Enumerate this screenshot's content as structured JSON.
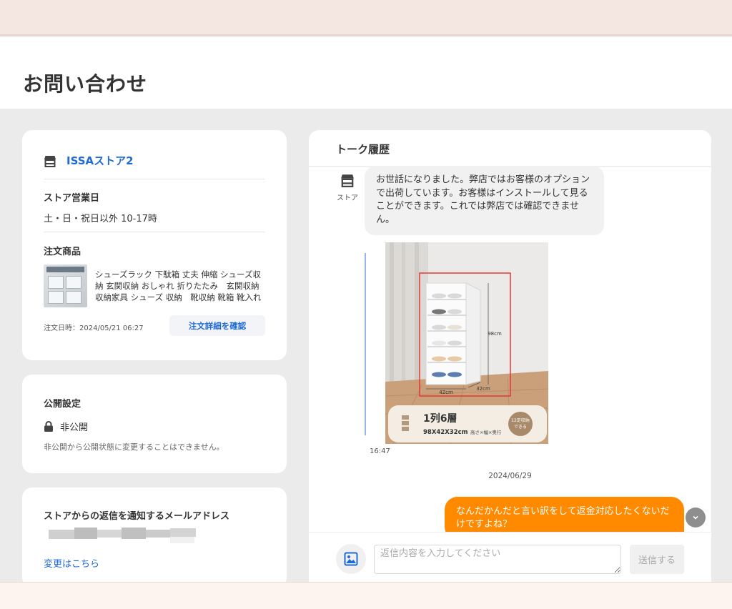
{
  "page": {
    "title": "お問い合わせ"
  },
  "store": {
    "name": "ISSAストア2",
    "hours_title": "ストア営業日",
    "hours": "土・日・祝日以外 10-17時",
    "order_title": "注文商品",
    "product_name": "シューズラック 下駄箱 丈夫 伸縮 シューズ収納 玄関収納 おしゃれ 折りたたみ　玄関収納 収納家具 シューズ 収納　靴収納 靴箱 靴入れ",
    "order_date": "注文日時：2024/05/21 06:27",
    "detail_button": "注文詳細を確認"
  },
  "visibility": {
    "title": "公開設定",
    "status": "非公開",
    "note": "非公開から公開状態に変更することはできません。"
  },
  "email": {
    "title": "ストアからの返信を通知するメールアドレス",
    "change_link": "変更はこちら"
  },
  "chat": {
    "title": "トーク履歴",
    "avatar_label": "ストア",
    "incoming_message": "お世話になりました。弊店ではお客様のオプションで出荷しています。お客様はインストールして見ることができます。これでは弊店では確認できません。",
    "image": {
      "height_label": "98cm",
      "width_label": "42cm",
      "depth_label": "32cm",
      "headline": "1列6層",
      "dims": "98X42X32cm",
      "dims_note": "高さ×幅×奥行",
      "badge_line1": "12足収納",
      "badge_line2": "できる"
    },
    "incoming_time": "16:47",
    "date_separator": "2024/06/29",
    "outgoing_message": "なんだかんだと言い訳をして返金対応したくないだけですよね？",
    "input_placeholder": "返信内容を入力してください",
    "send_button": "送信する"
  },
  "colors": {
    "accent_blue": "#1f6bd6",
    "outgoing_bubble": "#ff8a00"
  }
}
